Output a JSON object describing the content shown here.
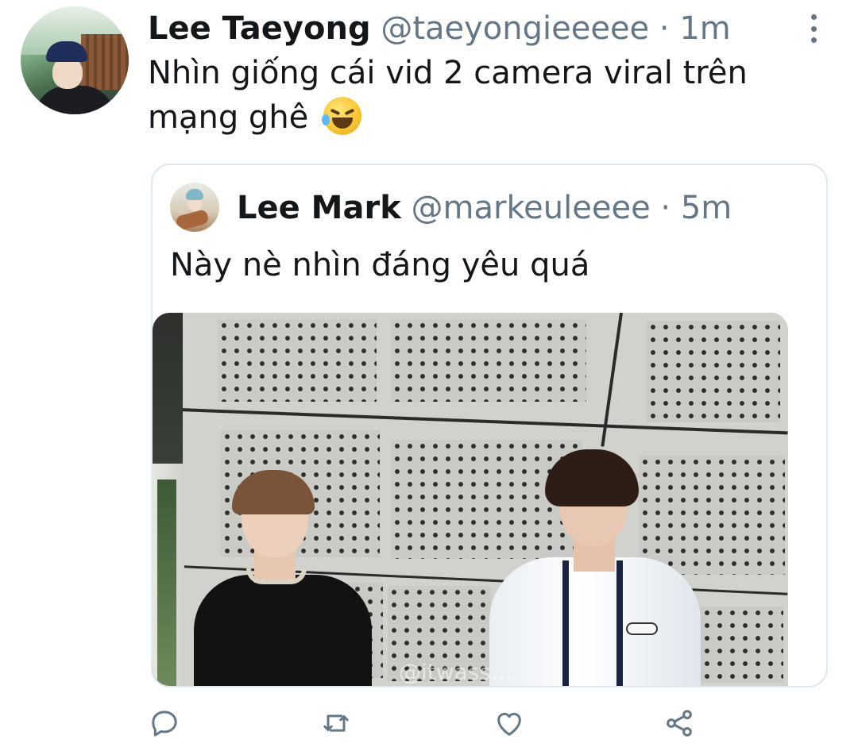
{
  "tweet": {
    "author_name": "Lee Taeyong",
    "author_handle": "@taeyongieeeee",
    "separator": "·",
    "timestamp": "1m",
    "text": "Nhìn giống cái vid 2 camera viral trên mạng ghê",
    "emoji": "rolling-on-floor-laughing-emoji"
  },
  "quoted_tweet": {
    "author_name": "Lee Mark",
    "author_handle": "@markeuleeee",
    "separator": "·",
    "timestamp": "5m",
    "text": "Này nè nhìn đáng yêu quá",
    "media_watermark": "@itwass..."
  },
  "actions": [
    {
      "name": "reply",
      "icon": "reply-icon"
    },
    {
      "name": "retweet",
      "icon": "retweet-icon"
    },
    {
      "name": "like",
      "icon": "heart-icon"
    },
    {
      "name": "share",
      "icon": "share-icon"
    }
  ],
  "colors": {
    "text_primary": "#14171a",
    "text_secondary": "#657786",
    "border": "#e1e8ed"
  }
}
